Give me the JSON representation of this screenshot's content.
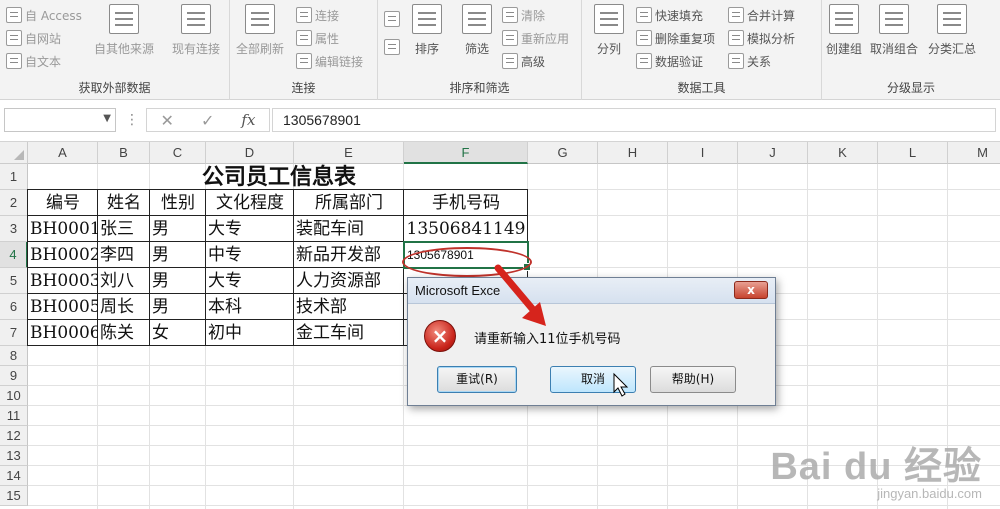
{
  "ribbon": {
    "groups": [
      {
        "title": "获取外部数据",
        "items": [
          "自 Access",
          "自网站",
          "自文本",
          "自其他来源",
          "现有连接"
        ]
      },
      {
        "title": "连接",
        "items": [
          "全部刷新",
          "连接",
          "属性",
          "编辑链接"
        ]
      },
      {
        "title": "排序和筛选",
        "items": [
          "排序",
          "筛选",
          "清除",
          "重新应用",
          "高级"
        ]
      },
      {
        "title": "数据工具",
        "items": [
          "分列",
          "快速填充",
          "删除重复项",
          "数据验证",
          "合并计算",
          "模拟分析",
          "关系"
        ]
      },
      {
        "title": "分级显示",
        "items": [
          "创建组",
          "取消组合",
          "分类汇总"
        ]
      }
    ]
  },
  "formula_bar": {
    "name_box": "",
    "formula": "1305678901"
  },
  "columns": [
    "A",
    "B",
    "C",
    "D",
    "E",
    "F",
    "G",
    "H",
    "I",
    "J",
    "K",
    "L",
    "M"
  ],
  "rows": [
    "1",
    "2",
    "3",
    "4",
    "5",
    "6",
    "7",
    "8",
    "9",
    "10",
    "11",
    "12",
    "13",
    "14",
    "15"
  ],
  "sheet": {
    "title": "公司员工信息表",
    "headers": [
      "编号",
      "姓名",
      "性别",
      "文化程度",
      "所属部门",
      "手机号码"
    ],
    "records": [
      [
        "BH0001",
        "张三",
        "男",
        "大专",
        "装配车间",
        "13506841149"
      ],
      [
        "BH0002",
        "李四",
        "男",
        "中专",
        "新品开发部",
        "1305678901"
      ],
      [
        "BH0003",
        "刘八",
        "男",
        "大专",
        "人力资源部",
        ""
      ],
      [
        "BH0005",
        "周长",
        "男",
        "本科",
        "技术部",
        ""
      ],
      [
        "BH0006",
        "陈关",
        "女",
        "初中",
        "金工车间",
        ""
      ]
    ]
  },
  "dialog": {
    "title": "Microsoft Exce",
    "close_label": "x",
    "message": "请重新输入11位手机号码",
    "buttons": [
      "重试(R)",
      "取消",
      "帮助(H)"
    ]
  },
  "watermark": {
    "logo": "Bai du 经验",
    "url": "jingyan.baidu.com"
  },
  "colors": {
    "accent": "#217346",
    "annotation": "#c0322b",
    "error": "#c8231a"
  }
}
